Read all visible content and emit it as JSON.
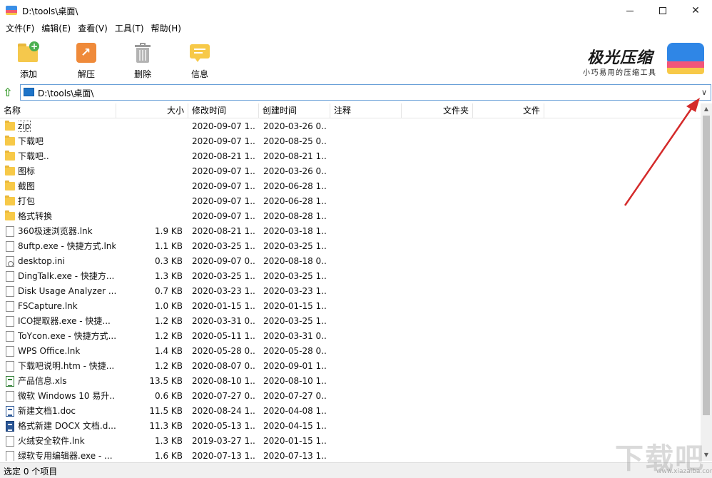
{
  "window": {
    "title": "D:\\tools\\桌面\\",
    "controls": {
      "minimize": "minimize",
      "maximize": "maximize",
      "close": "✕"
    }
  },
  "menu": [
    "文件(F)",
    "编辑(E)",
    "查看(V)",
    "工具(T)",
    "帮助(H)"
  ],
  "toolbar": {
    "add_label": "添加",
    "extract_label": "解压",
    "delete_label": "删除",
    "info_label": "信息"
  },
  "logo": {
    "title": "极光压缩",
    "subtitle": "小巧易用的压缩工具"
  },
  "address": {
    "path": "D:\\tools\\桌面\\",
    "dropdown_glyph": "∨"
  },
  "columns": [
    "名称",
    "大小",
    "修改时间",
    "创建时间",
    "注释",
    "文件夹",
    "文件"
  ],
  "files": [
    {
      "name": "zip",
      "size": "",
      "modified": "2020-09-07 1...",
      "created": "2020-03-26 0...",
      "type": "folder"
    },
    {
      "name": "下载吧",
      "size": "",
      "modified": "2020-09-07 1...",
      "created": "2020-08-25 0...",
      "type": "folder"
    },
    {
      "name": "下载吧..",
      "size": "",
      "modified": "2020-08-21 1...",
      "created": "2020-08-21 1...",
      "type": "folder"
    },
    {
      "name": "图标",
      "size": "",
      "modified": "2020-09-07 1...",
      "created": "2020-03-26 0...",
      "type": "folder"
    },
    {
      "name": "截图",
      "size": "",
      "modified": "2020-09-07 1...",
      "created": "2020-06-28 1...",
      "type": "folder"
    },
    {
      "name": "打包",
      "size": "",
      "modified": "2020-09-07 1...",
      "created": "2020-06-28 1...",
      "type": "folder"
    },
    {
      "name": "格式转换",
      "size": "",
      "modified": "2020-09-07 1...",
      "created": "2020-08-28 1...",
      "type": "folder"
    },
    {
      "name": "360极速浏览器.lnk",
      "size": "1.9 KB",
      "modified": "2020-08-21 1...",
      "created": "2020-03-18 1...",
      "type": "file"
    },
    {
      "name": "8uftp.exe - 快捷方式.lnk",
      "size": "1.1 KB",
      "modified": "2020-03-25 1...",
      "created": "2020-03-25 1...",
      "type": "file"
    },
    {
      "name": "desktop.ini",
      "size": "0.3 KB",
      "modified": "2020-09-07 0...",
      "created": "2020-08-18 0...",
      "type": "ini"
    },
    {
      "name": "DingTalk.exe - 快捷方...",
      "size": "1.3 KB",
      "modified": "2020-03-25 1...",
      "created": "2020-03-25 1...",
      "type": "file"
    },
    {
      "name": "Disk Usage Analyzer ...",
      "size": "0.7 KB",
      "modified": "2020-03-23 1...",
      "created": "2020-03-23 1...",
      "type": "file"
    },
    {
      "name": "FSCapture.lnk",
      "size": "1.0 KB",
      "modified": "2020-01-15 1...",
      "created": "2020-01-15 1...",
      "type": "file"
    },
    {
      "name": "ICO提取器.exe - 快捷...",
      "size": "1.2 KB",
      "modified": "2020-03-31 0...",
      "created": "2020-03-25 1...",
      "type": "file"
    },
    {
      "name": "ToYcon.exe - 快捷方式...",
      "size": "1.2 KB",
      "modified": "2020-05-11 1...",
      "created": "2020-03-31 0...",
      "type": "file"
    },
    {
      "name": "WPS Office.lnk",
      "size": "1.4 KB",
      "modified": "2020-05-28 0...",
      "created": "2020-05-28 0...",
      "type": "file"
    },
    {
      "name": "下载吧说明.htm - 快捷...",
      "size": "1.2 KB",
      "modified": "2020-08-07 0...",
      "created": "2020-09-01 1...",
      "type": "file"
    },
    {
      "name": "产品信息.xls",
      "size": "13.5 KB",
      "modified": "2020-08-10 1...",
      "created": "2020-08-10 1...",
      "type": "xls"
    },
    {
      "name": "微软 Windows 10 易升...",
      "size": "0.6 KB",
      "modified": "2020-07-27 0...",
      "created": "2020-07-27 0...",
      "type": "file"
    },
    {
      "name": "新建文档1.doc",
      "size": "11.5 KB",
      "modified": "2020-08-24 1...",
      "created": "2020-04-08 1...",
      "type": "doc"
    },
    {
      "name": "格式新建 DOCX 文档.d...",
      "size": "11.3 KB",
      "modified": "2020-05-13 1...",
      "created": "2020-04-15 1...",
      "type": "docx"
    },
    {
      "name": "火绒安全软件.lnk",
      "size": "1.3 KB",
      "modified": "2019-03-27 1...",
      "created": "2020-01-15 1...",
      "type": "file"
    },
    {
      "name": "绿软专用编辑器.exe - ...",
      "size": "1.6 KB",
      "modified": "2020-07-13 1...",
      "created": "2020-07-13 1...",
      "type": "file"
    }
  ],
  "status": "选定 0 个项目",
  "scrollbar": {
    "up": "▲",
    "down": "▼"
  },
  "watermark": {
    "text": "下载吧",
    "url": "www.xiazaiba.com"
  },
  "colors": {
    "annotation_arrow": "#d42a2a",
    "address_border": "#6aa0d8",
    "folder": "#f7c948"
  }
}
